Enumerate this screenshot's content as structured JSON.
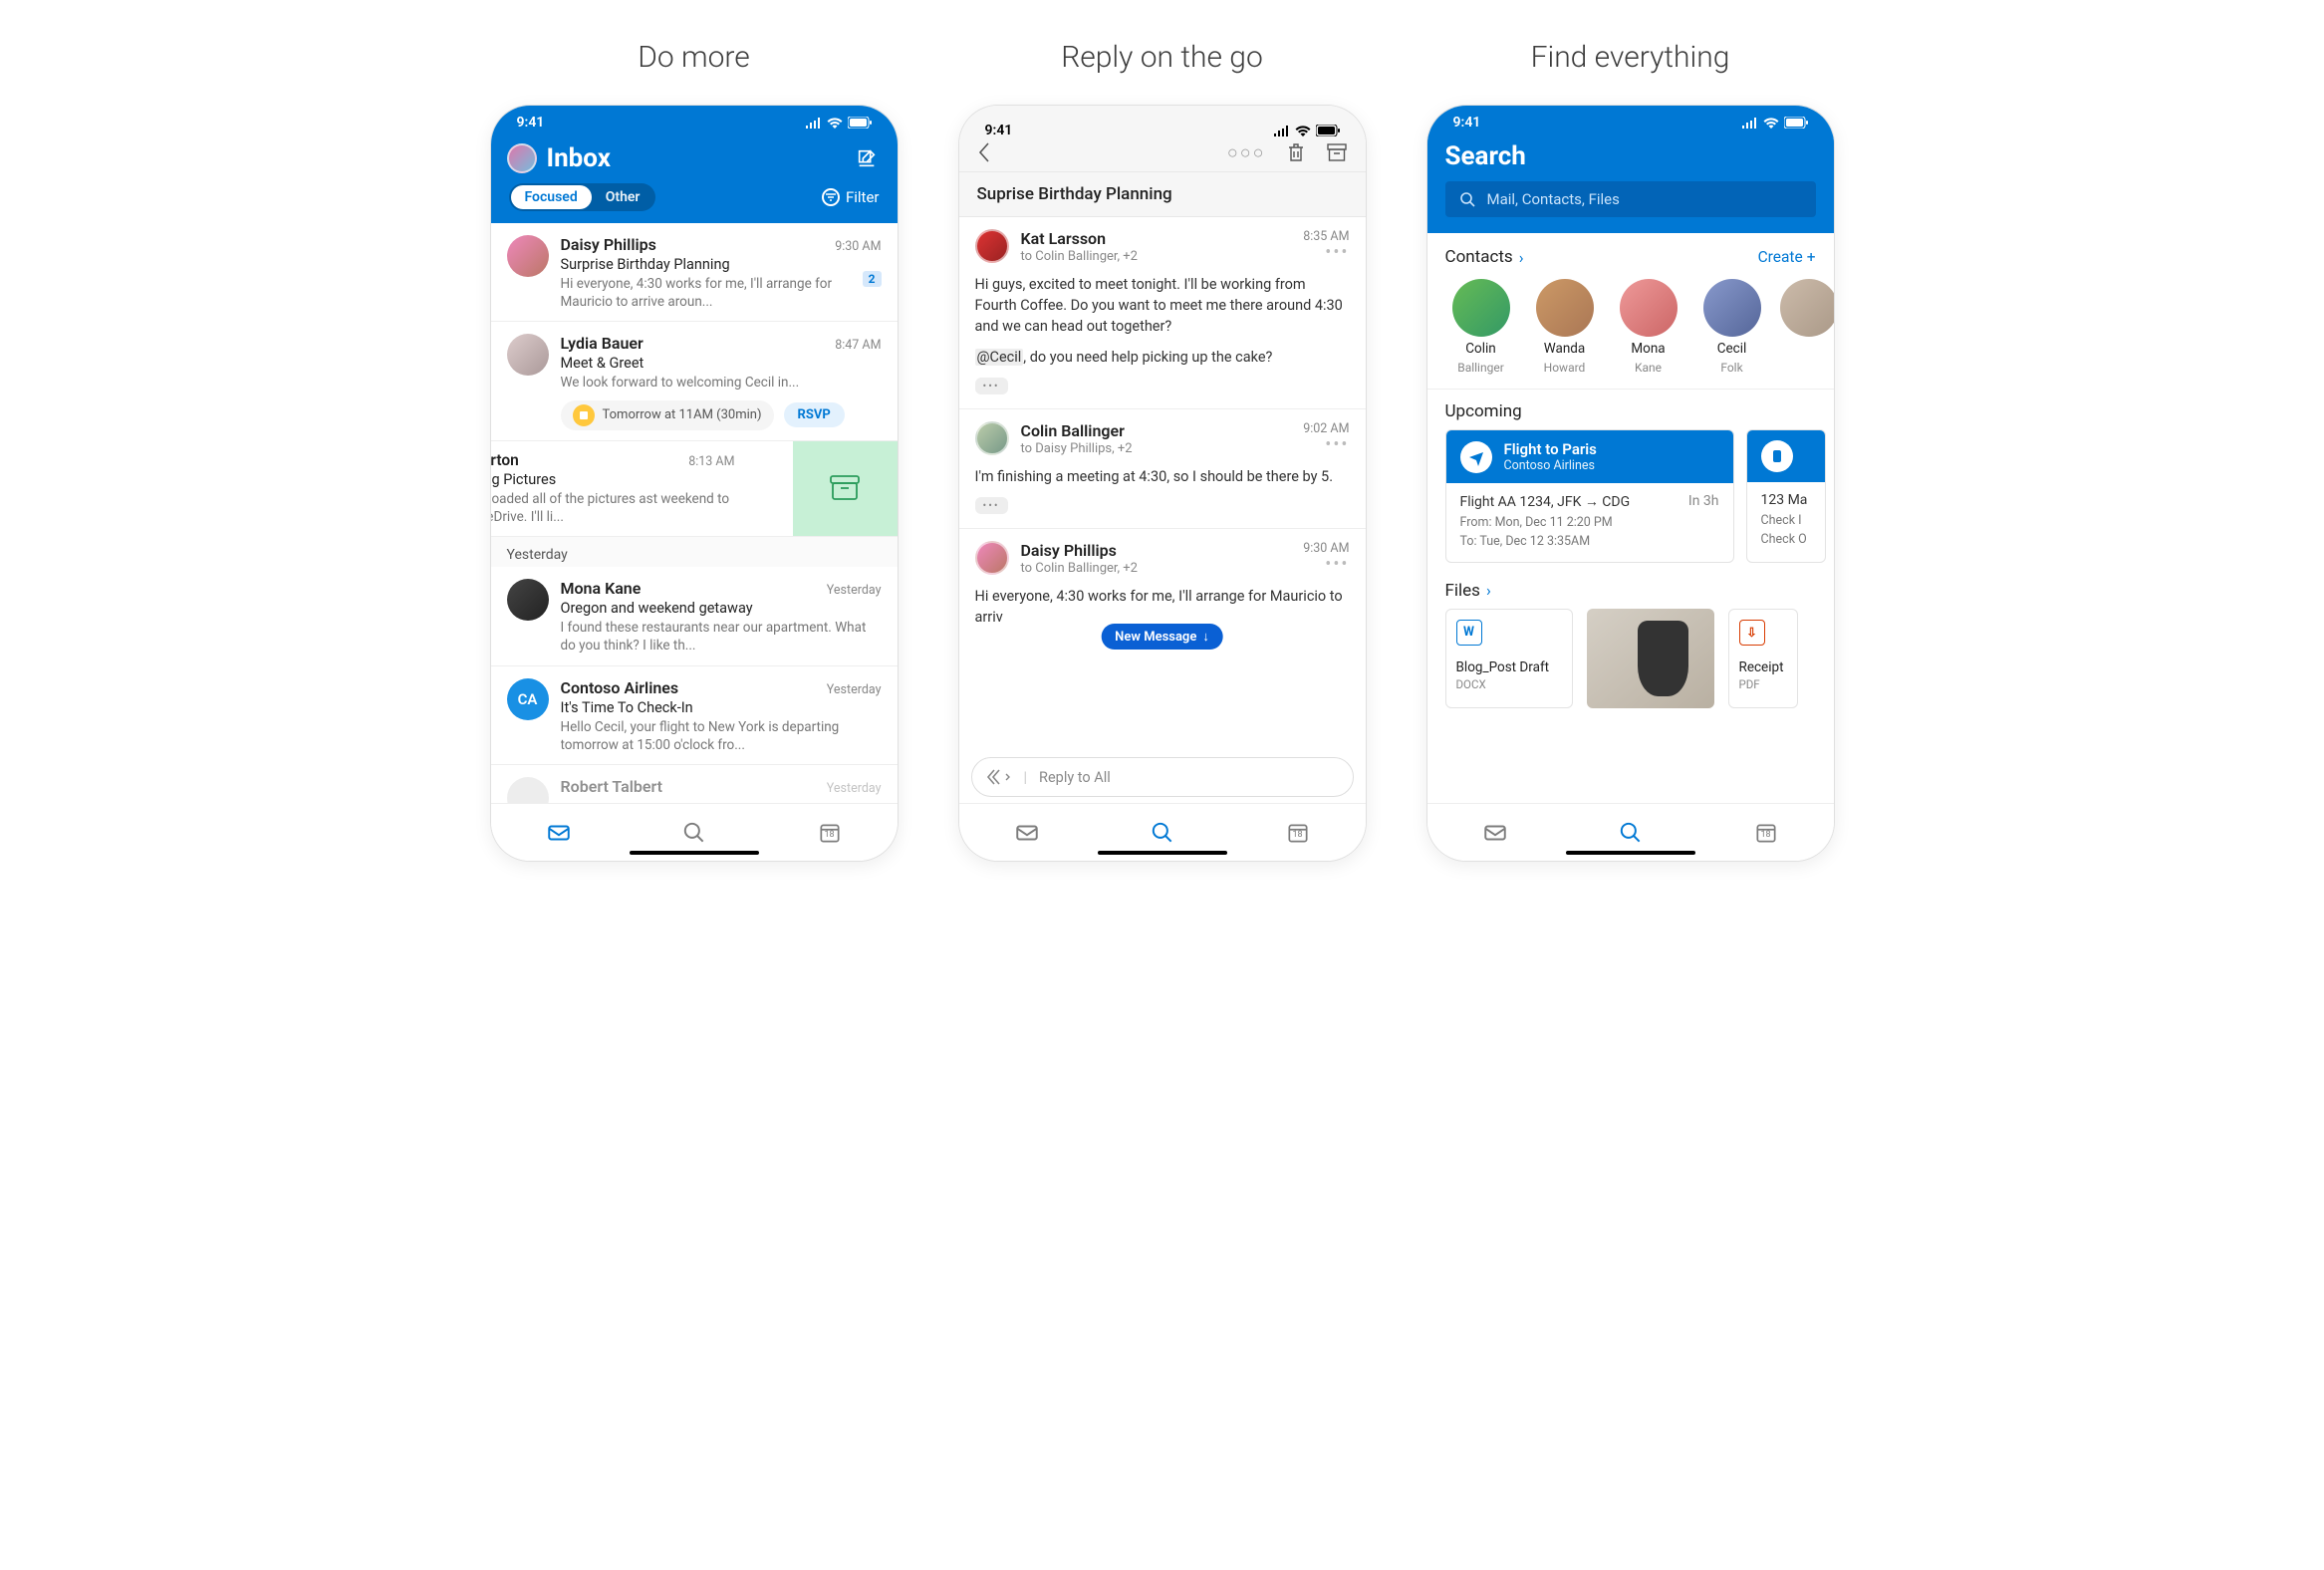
{
  "panels": {
    "p1_title": "Do more",
    "p2_title": "Reply on the go",
    "p3_title": "Find everything"
  },
  "status": {
    "time": "9:41"
  },
  "inbox": {
    "title": "Inbox",
    "focused": "Focused",
    "other": "Other",
    "filter": "Filter",
    "items": [
      {
        "sender": "Daisy Phillips",
        "time": "9:30 AM",
        "subject": "Surprise Birthday Planning",
        "preview": "Hi everyone, 4:30 works for me, I'll arrange for Mauricio to arrive aroun...",
        "count": "2"
      },
      {
        "sender": "Lydia Bauer",
        "time": "8:47 AM",
        "subject": "Meet & Greet",
        "preview": "We look forward to welcoming Cecil in...",
        "rsvp_time": "Tomorrow at 11AM (30min)",
        "rsvp": "RSVP"
      }
    ],
    "swiped": {
      "sender": "ste Burton",
      "time": "8:13 AM",
      "subject": "Bonding Pictures",
      "preview": "cil, I uploaded all of the pictures ast weekend to our OneDrive. I'll li..."
    },
    "section": "Yesterday",
    "below": [
      {
        "sender": "Mona Kane",
        "time": "Yesterday",
        "subject": "Oregon and weekend getaway",
        "preview": "I found these restaurants near our apartment. What do you think? I like th..."
      },
      {
        "sender": "Contoso Airlines",
        "initials": "CA",
        "time": "Yesterday",
        "subject": "It's Time To Check-In",
        "preview": "Hello Cecil, your flight to New York is departing tomorrow at 15:00 o'clock fro..."
      },
      {
        "sender": "Robert Talbert",
        "time": "Yesterday",
        "subject": "",
        "preview": ""
      }
    ]
  },
  "thread": {
    "subject": "Suprise Birthday Planning",
    "msgs": [
      {
        "from": "Kat Larsson",
        "to": "to Colin Ballinger, +2",
        "time": "8:35 AM",
        "body1": "Hi guys, excited to meet tonight. I'll be working from Fourth Coffee. Do you want to meet me there around 4:30 and we can head out together?",
        "body2_pre": "@Cecil",
        "body2_post": ", do you need help picking up the cake?"
      },
      {
        "from": "Colin Ballinger",
        "to": "to Daisy Phillips, +2",
        "time": "9:02 AM",
        "body1": "I'm finishing a meeting at 4:30, so I should be there by 5."
      },
      {
        "from": "Daisy Phillips",
        "to": "to Colin Ballinger, +2",
        "time": "9:30 AM",
        "body1": "Hi everyone, 4:30 works for me, I'll arrange for Mauricio to arriv"
      }
    ],
    "new_message": "New Message",
    "reply_placeholder": "Reply to All"
  },
  "search": {
    "title": "Search",
    "placeholder": "Mail, Contacts, Files",
    "contacts_label": "Contacts",
    "create_label": "Create",
    "contacts": [
      {
        "first": "Colin",
        "last": "Ballinger"
      },
      {
        "first": "Wanda",
        "last": "Howard"
      },
      {
        "first": "Mona",
        "last": "Kane"
      },
      {
        "first": "Cecil",
        "last": "Folk"
      }
    ],
    "upcoming": "Upcoming",
    "card1": {
      "title": "Flight to Paris",
      "sub": "Contoso Airlines",
      "line1": "Flight AA 1234, JFK → CDG",
      "in": "In 3h",
      "from": "From: Mon, Dec 11 2:20 PM",
      "to": "To: Tue, Dec 12 3:35AM"
    },
    "card2": {
      "title": "123 Ma",
      "from": "Check I",
      "to": "Check O"
    },
    "files_label": "Files",
    "file1": {
      "name": "Blog_Post Draft",
      "ext": "DOCX",
      "icon": "W"
    },
    "file2": {
      "name": "Receipt",
      "ext": "PDF",
      "icon": "⇩"
    }
  },
  "tabbar": {
    "cal_num": "18"
  }
}
